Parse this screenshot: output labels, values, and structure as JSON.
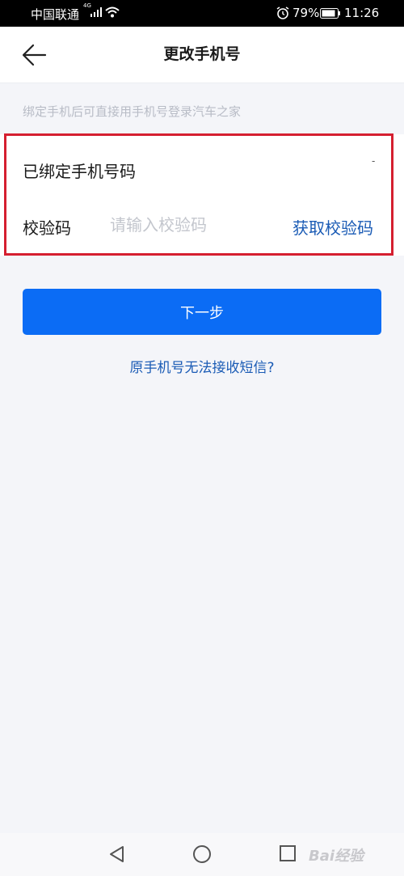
{
  "status_bar": {
    "carrier": "中国联通",
    "network_badge": "4G",
    "battery_percent": "79%",
    "time": "11:26",
    "icons": [
      "signal-icon",
      "wifi-icon",
      "alarm-icon",
      "battery-icon"
    ]
  },
  "header": {
    "title": "更改手机号",
    "back_icon": "back-arrow-icon"
  },
  "hint": "绑定手机后可直接用手机号登录汽车之家",
  "form": {
    "bound_label": "已绑定手机号码",
    "bound_value": "-",
    "code_label": "校验码",
    "code_value": "",
    "code_placeholder": "请输入校验码",
    "get_code_label": "获取校验码"
  },
  "next_button_label": "下一步",
  "help_link": "原手机号无法接收短信?",
  "nav_bar": {
    "icons": [
      "triangle-back-icon",
      "circle-home-icon",
      "square-recent-icon"
    ]
  },
  "watermark": "Bai经验",
  "colors": {
    "primary": "#0b6cf5",
    "link": "#1a5bb5",
    "highlight_border": "#d51f30",
    "page_background": "#f4f5f9"
  }
}
